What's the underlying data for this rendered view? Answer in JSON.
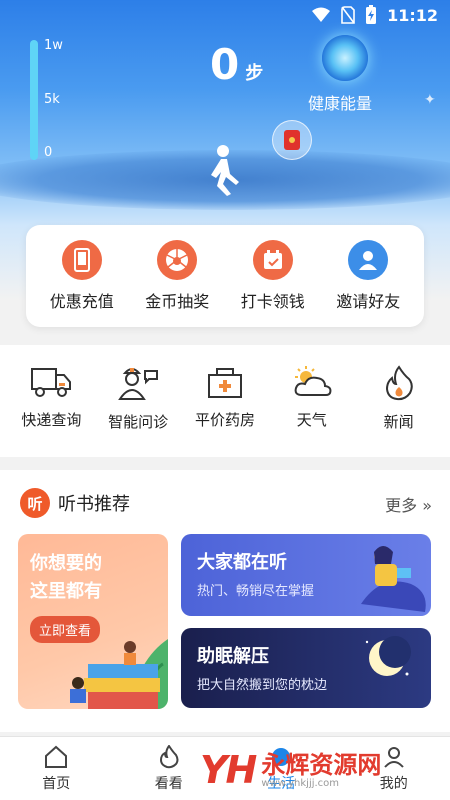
{
  "status": {
    "time": "11:12"
  },
  "gauge": {
    "labels": [
      "1w",
      "5k",
      "0"
    ]
  },
  "steps": {
    "value": "0",
    "unit": "步"
  },
  "energy": {
    "label": "健康能量"
  },
  "quick_actions": [
    {
      "label": "优惠充值",
      "icon": "phone-icon",
      "color": "#ef6a45"
    },
    {
      "label": "金币抽奖",
      "icon": "lottery-wheel-icon",
      "color": "#ef6a45"
    },
    {
      "label": "打卡领钱",
      "icon": "calendar-check-icon",
      "color": "#ef6a45"
    },
    {
      "label": "邀请好友",
      "icon": "user-icon",
      "color": "#3c8ee8"
    }
  ],
  "services": [
    {
      "label": "快递查询",
      "icon": "truck-icon"
    },
    {
      "label": "智能问诊",
      "icon": "doctor-icon"
    },
    {
      "label": "平价药房",
      "icon": "medicine-box-icon"
    },
    {
      "label": "天气",
      "icon": "weather-icon"
    },
    {
      "label": "新闻",
      "icon": "flame-icon"
    }
  ],
  "audio": {
    "badge": "听",
    "title": "听书推荐",
    "more": "更多",
    "card_left": {
      "title": "你想要的\n这里都有",
      "cta": "立即查看"
    },
    "card_right_1": {
      "title": "大家都在听",
      "subtitle": "热门、畅销尽在掌握"
    },
    "card_right_2": {
      "title": "助眠解压",
      "subtitle": "把大自然搬到您的枕边"
    }
  },
  "nav": [
    {
      "label": "首页",
      "icon": "home-icon",
      "active": false
    },
    {
      "label": "看看",
      "icon": "flame-icon",
      "active": false
    },
    {
      "label": "生活",
      "icon": "life-icon",
      "active": true
    },
    {
      "label": "我的",
      "icon": "profile-icon",
      "active": false
    }
  ],
  "watermark": {
    "logo": "YH",
    "main": "永辉资源网",
    "sub": "www.yhkjjj.com"
  },
  "colors": {
    "accent": "#1d86e8",
    "orange": "#ef6a45",
    "sky": "#2d7fe8"
  }
}
